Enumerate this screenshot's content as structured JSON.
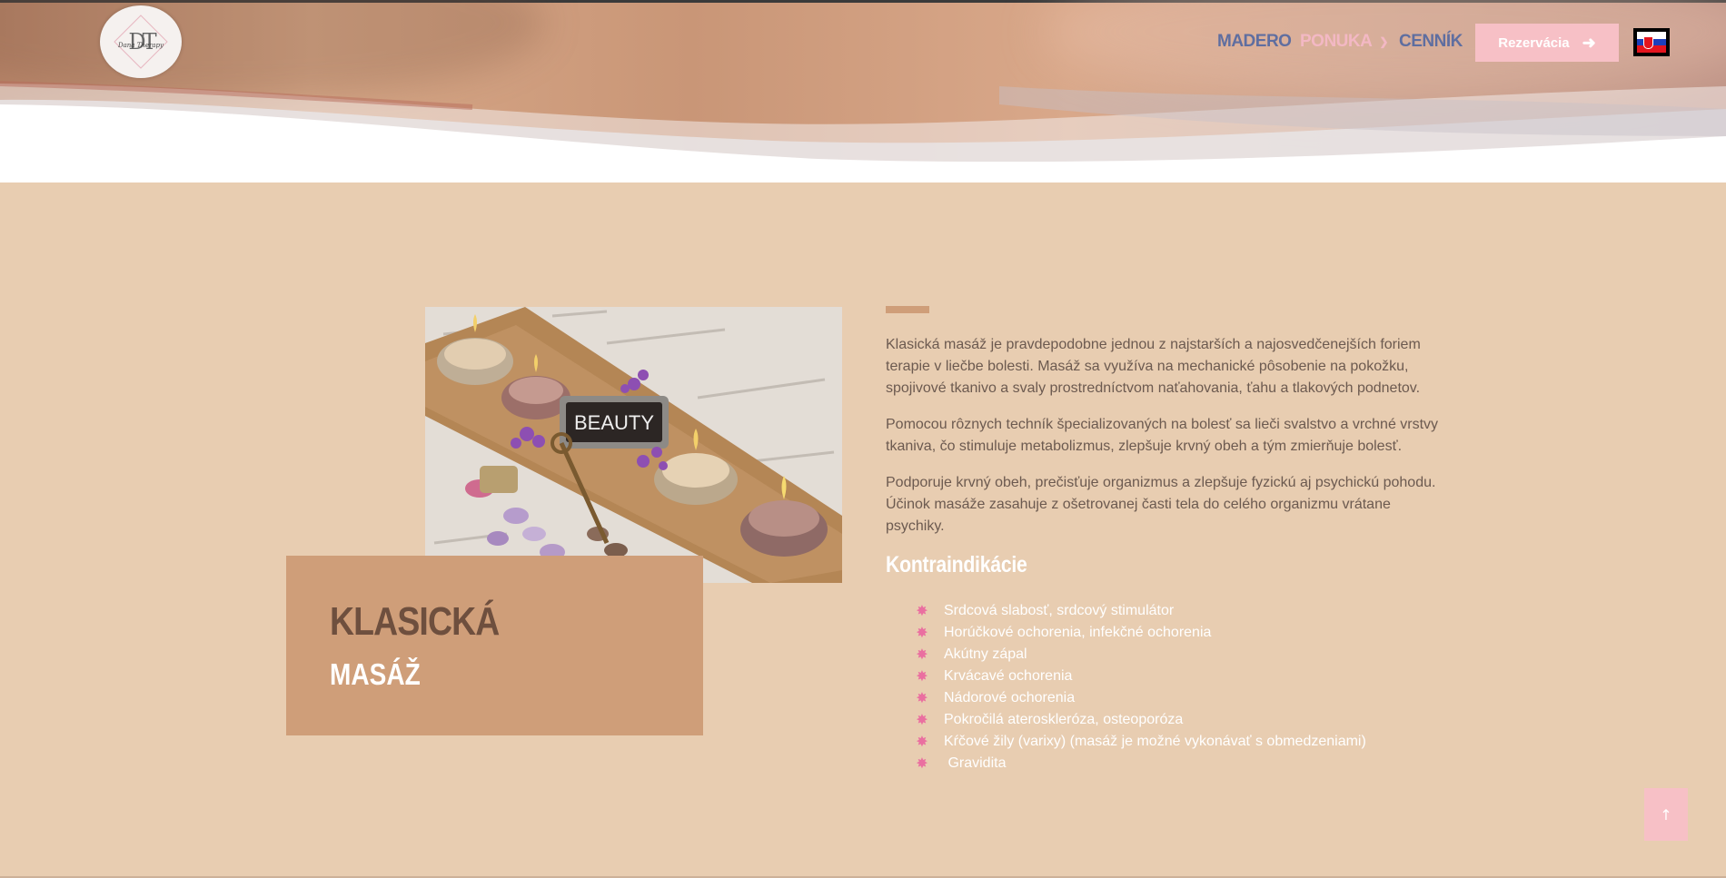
{
  "header": {
    "logo_text": "DT",
    "logo_script": "Dana Therapy",
    "nav": {
      "madero": "MADERO",
      "ponuka": "PONUKA",
      "cennik": "CENNÍK"
    },
    "reservation_button": "Rezervácia",
    "language_flag": "slovak-flag-icon"
  },
  "hero_image": {
    "badge_text": "BEAUTY"
  },
  "title": {
    "main": "KLASICKÁ",
    "sub": "MASÁŽ"
  },
  "content": {
    "paragraphs": [
      "Klasická masáž je pravdepodobne jednou z najstarších a najosvedčenejších foriem terapie v liečbe bolesti. Masáž sa využíva na mechanické pôsobenie na pokožku, spojivové tkanivo a svaly prostredníctvom naťahovania, ťahu a tlakových podnetov.",
      "Pomocou rôznych techník špecializovaných na bolesť sa lieči svalstvo a vrchné vrstvy tkaniva, čo stimuluje metabolizmus, zlepšuje krvný obeh a tým zmierňuje bolesť.",
      "Podporuje krvný obeh, prečisťuje organizmus a zlepšuje fyzickú aj psychickú pohodu. Účinok masáže zasahuje z ošetrovanej časti tela do celého organizmu vrátane psychiky."
    ],
    "contraindications_heading": "Kontraindikácie",
    "contraindications": [
      "Srdcová slabosť, srdcový stimulátor",
      "Horúčkové ochorenia, infekčné ochorenia",
      "Akútny zápal",
      "Krvácavé ochorenia",
      "Nádorové ochorenia",
      "Pokročilá ateroskleróza, osteoporóza",
      "Kŕčové žily (varixy) (masáž je možné vykonávať s obmedzeniami)",
      " Gravidita"
    ]
  },
  "scroll_top_icon": "arrow-up-icon",
  "colors": {
    "page_bg": "#e8cdb1",
    "accent_tan": "#cf9e79",
    "pink": "#f7c0c6",
    "nav_blue": "#5f6ea0",
    "bullet_pink": "#ea6fa0"
  }
}
